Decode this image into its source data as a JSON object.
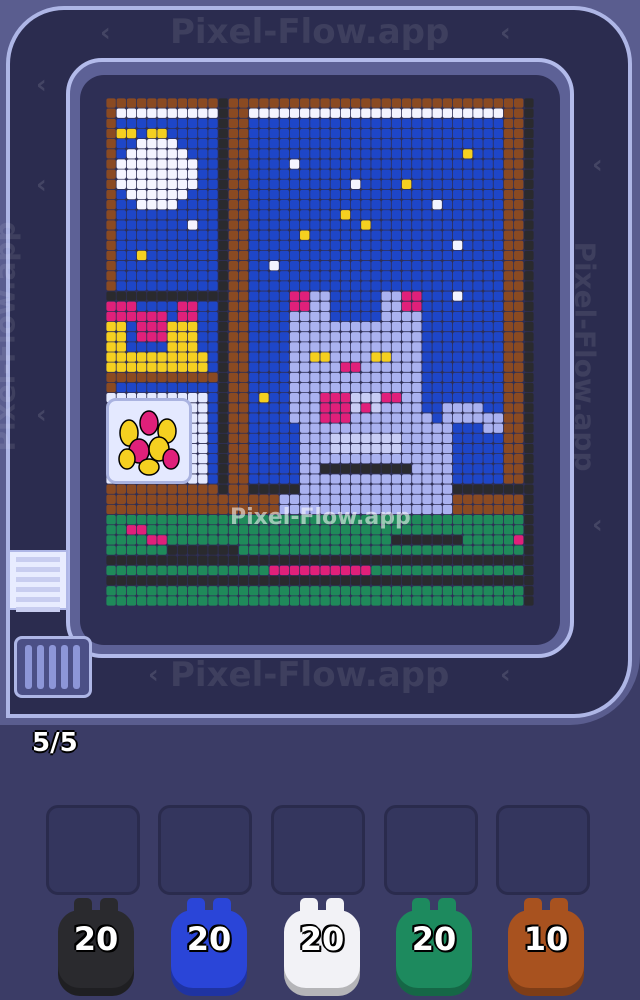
{
  "watermark": "Pixel-Flow.app",
  "progress": {
    "label": "5/5",
    "current": 5,
    "total": 5
  },
  "colors": {
    "background": "#3b3c66",
    "track": "#aeb6e6",
    "sky": "#1e46c8",
    "frame": "#8a4a22",
    "cat": "#aab2f0",
    "pink": "#e0207a",
    "yellow": "#f5d020",
    "grass": "#1f8a5a"
  },
  "slots": [
    {
      "empty": true
    },
    {
      "empty": true
    },
    {
      "empty": true
    },
    {
      "empty": true
    },
    {
      "empty": true
    }
  ],
  "shooters": [
    {
      "color_name": "black",
      "color": "#2a2a2e",
      "count": "20"
    },
    {
      "color_name": "blue",
      "color": "#2a45d8",
      "count": "20"
    },
    {
      "color_name": "white",
      "color": "#f2f2f6",
      "count": "20"
    },
    {
      "color_name": "green",
      "color": "#1d8a5e",
      "count": "20"
    },
    {
      "color_name": "brown",
      "color": "#a8521f",
      "count": "10"
    }
  ],
  "icons": {
    "chevron": "chevron-left-icon",
    "jar": "jelly-bean-jar-icon"
  }
}
